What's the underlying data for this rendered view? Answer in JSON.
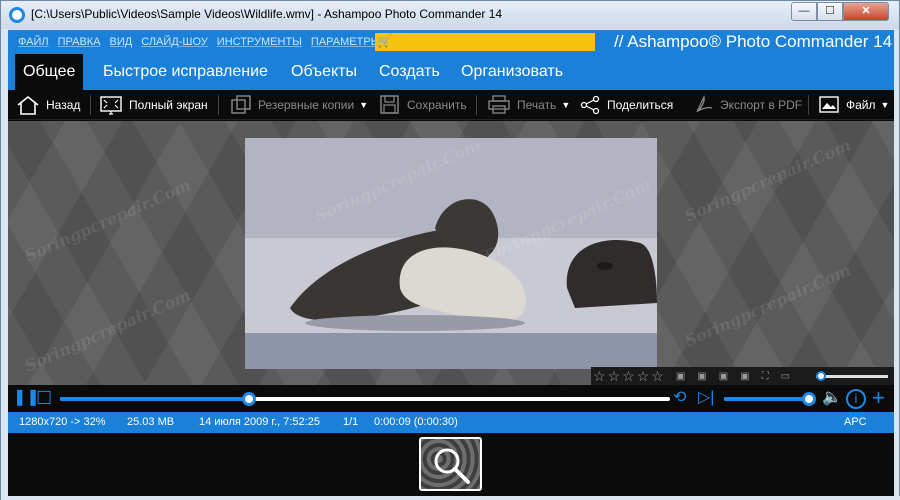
{
  "window": {
    "title": "[C:\\Users\\Public\\Videos\\Sample Videos\\Wildlife.wmv] - Ashampoo Photo Commander 14",
    "minimize": "—",
    "maximize": "☐",
    "close": "✕"
  },
  "menu": {
    "items": [
      "ФАЙЛ",
      "ПРАВКА",
      "ВИД",
      "СЛАЙД-ШОУ",
      "ИНСТРУМЕНТЫ",
      "ПАРАМЕТРЫ"
    ],
    "brand": "// Ashampoo® Photo Commander 14"
  },
  "tabs": [
    "Общее",
    "Быстрое исправление",
    "Объекты",
    "Создать",
    "Организовать"
  ],
  "toolbar": {
    "back": "Назад",
    "fullscreen": "Полный экран",
    "backups": "Резервные копии",
    "save": "Сохранить",
    "print": "Печать",
    "share": "Поделиться",
    "export_pdf": "Экспорт в PDF",
    "file": "Файл"
  },
  "watermark": "Soringpcrepair.Com",
  "playback": {
    "progress": 0.31,
    "volume": 0.97
  },
  "status": {
    "resolution": "1280x720 -> 32%",
    "size": "25.03 MB",
    "date": "14 июля 2009 г., 7:52:25",
    "index": "1/1",
    "time": "0:00:09 (0:00:30)",
    "arc": "APC"
  },
  "colors": {
    "accent": "#1b80d8",
    "promo": "#f6c40c"
  },
  "icons": {
    "back": "home-icon",
    "fullscreen": "fullscreen-icon",
    "backups": "backup-icon",
    "save": "floppy-icon",
    "print": "printer-icon",
    "share": "share-icon",
    "export_pdf": "pdf-icon",
    "file": "image-file-icon"
  }
}
